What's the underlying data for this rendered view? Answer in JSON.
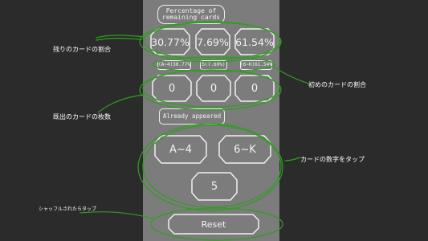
{
  "header": {
    "title": "Percentage of remaining cards"
  },
  "remaining": {
    "values": [
      "30.77%",
      "7.69%",
      "61.54%"
    ]
  },
  "initial": {
    "values": [
      "(A~4)30.77%",
      "5(7.69%)",
      "(6~K)61.54%"
    ]
  },
  "counts": {
    "values": [
      "0",
      "0",
      "0"
    ]
  },
  "appeared_label": "Already appeared",
  "buttons": {
    "a4": "A~4",
    "6k": "6~K",
    "five": "5"
  },
  "reset_label": "Reset",
  "annotations": {
    "remaining": "残りのカードの割合",
    "initial": "初めのカードの割合",
    "appeared": "既出のカードの枚数",
    "tap": "カードの数字をタップ",
    "shuffle": "シャッフルされたらタップ"
  },
  "colors": {
    "background": "#2b2b2b",
    "panel": "#7c7c7c",
    "outline": "#f0f0f0",
    "annotation_stroke": "#2f9e1f"
  }
}
